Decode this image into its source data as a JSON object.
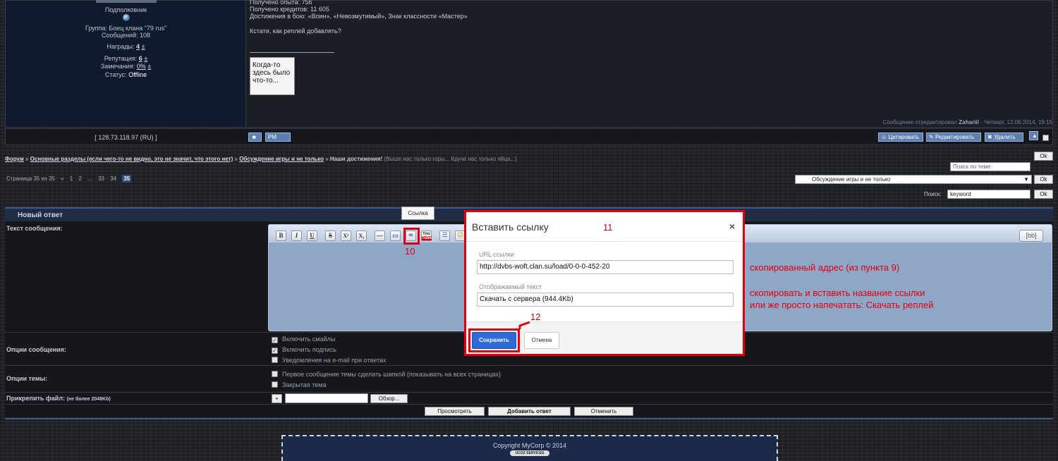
{
  "post": {
    "user": {
      "rank": "Подполковник",
      "group": "Группа: Боец клана \"79 rus\"",
      "messages": "Сообщений: 108",
      "awards_label": "Награды:",
      "awards_value": "4",
      "reputation_label": "Репутация:",
      "reputation_value": "6",
      "warnings_label": "Замечания:",
      "warnings_value": "0%",
      "status_label": "Статус:",
      "status_value": "Offline",
      "plus_minus": "±"
    },
    "body": {
      "line1": "Получено опыта: 756",
      "line2": "Получено кредитов: 11 605",
      "line3": "Достижения в бою: «Воин», «Невозмутимый», Знак классности «Мастер»",
      "line4": "Кстати, как реплей добавлять?",
      "signature": "Когда-то здесь было что-то..."
    },
    "edited_prefix": "Сообщение отредактировал",
    "edited_user": "Zahariil",
    "edited_suffix": "- Четверг, 12.06.2014, 19:15",
    "ip": "[ 128.73.118.97 (RU) ]",
    "actions": {
      "pm": "PM",
      "quote": "Цитировать",
      "edit": "Редактировать",
      "delete": "Удалить"
    }
  },
  "breadcrumb": {
    "forum": "Форум",
    "sep": "»",
    "section": "Основные разделы (если чего-то не видно, это не значит, что этого нет)",
    "subforum": "Обсуждение игры и не только",
    "topic": "Наши достижения!",
    "topic_desc": "(Выше нас только горы... Круче нас только яйца...)"
  },
  "pager": {
    "label": "Страница 35 из 35",
    "prev": "«",
    "p1": "1",
    "p2": "2",
    "dots": "...",
    "p33": "33",
    "p34": "34",
    "p35": "35"
  },
  "topic_search": {
    "placeholder": "Поиск по теме",
    "ok": "Ok"
  },
  "forum_select": {
    "value": "Обсуждение игры и не только",
    "arrow": "▼",
    "ok": "Ok"
  },
  "search": {
    "label": "Поиск:",
    "value": "keyword",
    "ok": "Ok"
  },
  "reply": {
    "title": "Новый ответ",
    "message_label": "Текст сообщения:",
    "toolbar": {
      "bold": "B",
      "italic": "I",
      "underline": "U",
      "strike": "S",
      "sup": "X²",
      "sub": "X₂",
      "hr": "—",
      "img": "▭",
      "link": "∞",
      "youtube_top": "You",
      "youtube_bottom": "Tube",
      "list": "☰",
      "smile": "☺"
    },
    "bb_label": "[bb]",
    "tooltip": "Ссылка",
    "options_label": "Опции сообщения:",
    "opt_smiles": "Включить смайлы",
    "opt_signature": "Включить подпись",
    "opt_email": "Уведомления на e-mail при ответах",
    "topic_options_label": "Опции темы:",
    "opt_pin_first": "Первое сообщение темы сделать шапкой (показывать на всех страницах)",
    "opt_closed": "Закрытая тема",
    "attach_label": "Прикрепить файл:",
    "attach_note": "(не более 2048Kb)",
    "attach_add": "+",
    "browse": "Обзор...",
    "preview": "Просмотреть",
    "submit": "Добавить ответ",
    "cancel": "Отменить",
    "check": "✓"
  },
  "modal": {
    "title": "Вставить ссылку",
    "close": "×",
    "url_label": "URL ссылки",
    "url_value": "http://dvbs-woft.clan.su/load/0-0-0-452-20",
    "text_label": "Отображаемый текст",
    "text_value": "Скачать с сервера (944.4Kb)",
    "save": "Сохранить",
    "cancel": "Отмена"
  },
  "annotations": {
    "n10": "10",
    "n11": "11",
    "n12": "12",
    "copied": "скопированный адрес (из пункта 9)",
    "paste1": "скопировать и вставить название ссылки",
    "paste2": "или же просто напечатать: Скачать реплей"
  },
  "footer": {
    "copyright": "Copyright MyCorp © 2014",
    "ucoz": "UCOZ SERVICES"
  },
  "colors": {
    "annotation_red": "#e00010",
    "save_blue": "#2e6bd8",
    "header_blue": "#3a5a8e"
  }
}
